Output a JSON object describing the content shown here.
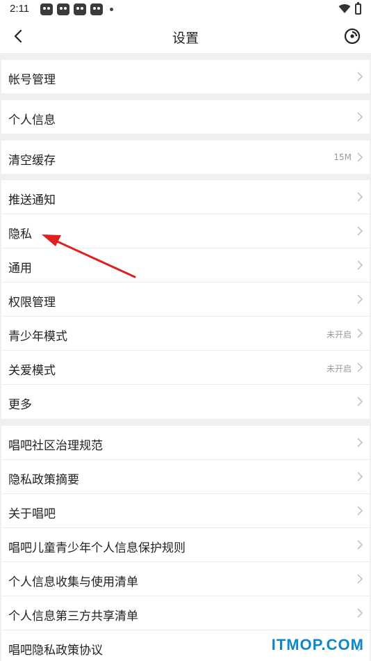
{
  "status_bar": {
    "time": "2:11"
  },
  "header": {
    "title": "设置"
  },
  "groups": [
    {
      "items": [
        {
          "label": "帐号管理",
          "value": ""
        }
      ]
    },
    {
      "items": [
        {
          "label": "个人信息",
          "value": ""
        }
      ]
    },
    {
      "items": [
        {
          "label": "清空缓存",
          "value": "15M"
        }
      ]
    },
    {
      "items": [
        {
          "label": "推送通知",
          "value": ""
        },
        {
          "label": "隐私",
          "value": ""
        },
        {
          "label": "通用",
          "value": ""
        },
        {
          "label": "权限管理",
          "value": ""
        },
        {
          "label": "青少年模式",
          "value": "未开启"
        },
        {
          "label": "关爱模式",
          "value": "未开启"
        },
        {
          "label": "更多",
          "value": ""
        }
      ]
    },
    {
      "items": [
        {
          "label": "唱吧社区治理规范",
          "value": ""
        },
        {
          "label": "隐私政策摘要",
          "value": ""
        },
        {
          "label": "关于唱吧",
          "value": ""
        },
        {
          "label": "唱吧儿童青少年个人信息保护规则",
          "value": ""
        },
        {
          "label": "个人信息收集与使用清单",
          "value": ""
        },
        {
          "label": "个人信息第三方共享清单",
          "value": ""
        },
        {
          "label": "唱吧隐私政策协议",
          "value": ""
        }
      ]
    }
  ],
  "watermark": "ITMOP.COM",
  "colors": {
    "annotation_arrow": "#e02020",
    "watermark": "#0e86c9"
  }
}
